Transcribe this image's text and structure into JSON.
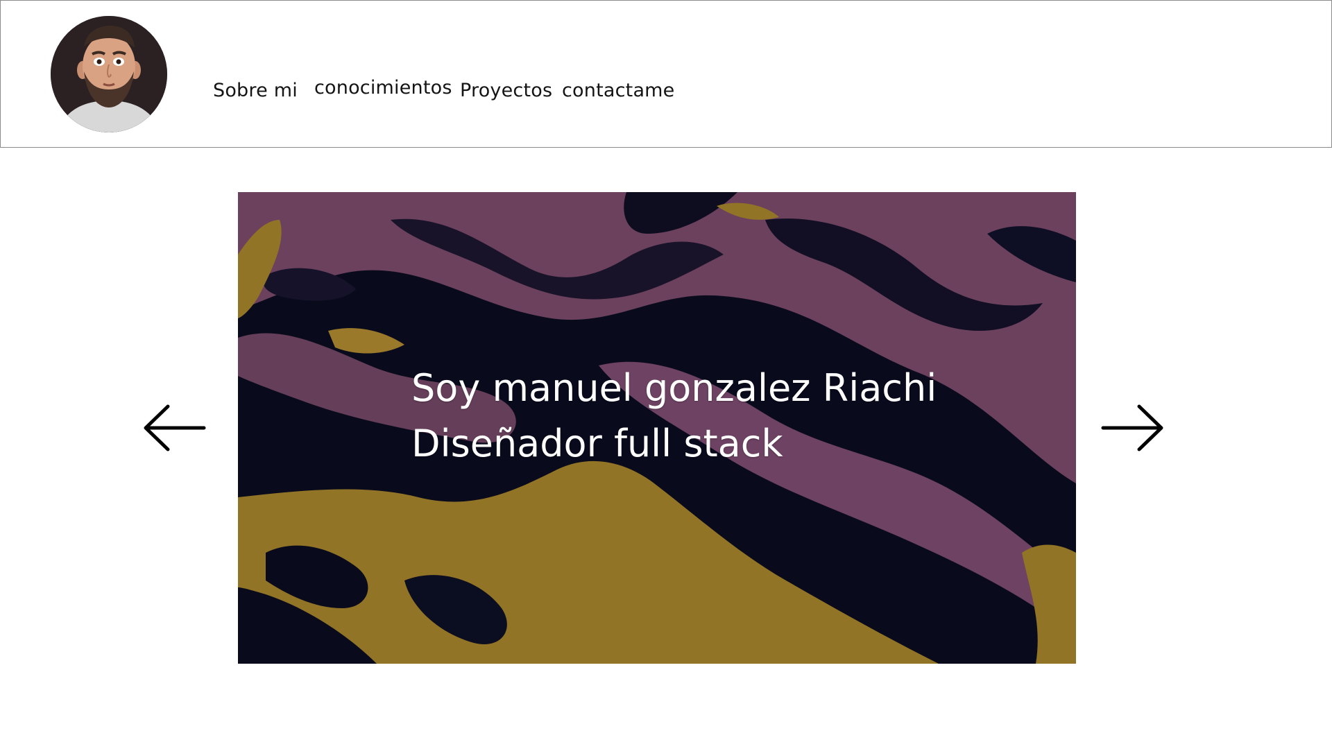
{
  "header": {
    "avatar_alt": "profile avatar",
    "nav": [
      {
        "label": "Sobre mi"
      },
      {
        "label": "conocimientos"
      },
      {
        "label": "Proyectos"
      },
      {
        "label": "contactame"
      }
    ]
  },
  "hero": {
    "line1": "Soy manuel gonzalez Riachi",
    "line2": "Diseñador full stack",
    "colors": {
      "purple": "#7a4a6c",
      "navy": "#0b0d22",
      "gold": "#a7842c"
    }
  },
  "controls": {
    "prev_icon": "arrow-left-icon",
    "next_icon": "arrow-right-icon"
  }
}
